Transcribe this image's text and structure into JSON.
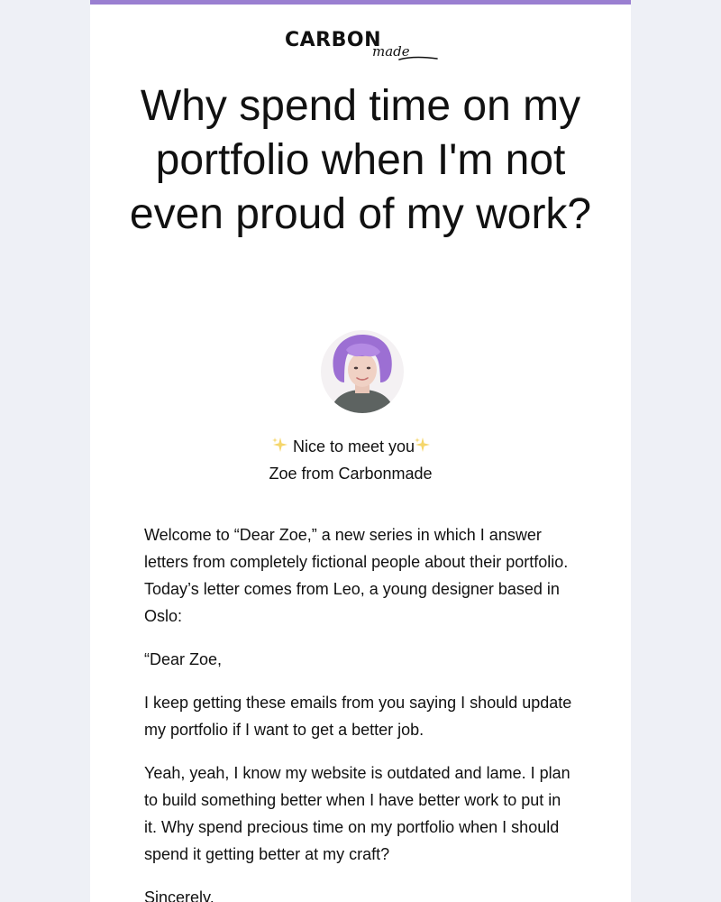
{
  "brand": {
    "logo_word": "CARBON",
    "logo_script": "made",
    "accent_color": "#9a7fd1"
  },
  "headline": "Why spend time on my portfolio when I'm not even proud of my work?",
  "intro": {
    "greeting": "Nice to meet you",
    "sender": "Zoe from Carbonmade",
    "sparkle_icon": "sparkles-icon"
  },
  "letter": {
    "paragraphs": [
      "Welcome to “Dear Zoe,” a new series in which I answer letters from completely fictional people about their portfolio. Today’s letter comes from Leo, a young designer based in Oslo:",
      "“Dear Zoe,",
      "I keep getting these emails from you saying I should update my portfolio if I want to get a better job.",
      "Yeah, yeah, I know my website is outdated and lame. I plan to build something better when I have better work to put in it. Why spend precious time on my portfolio when I should spend it getting better at my craft?",
      "Sincerely,"
    ]
  }
}
